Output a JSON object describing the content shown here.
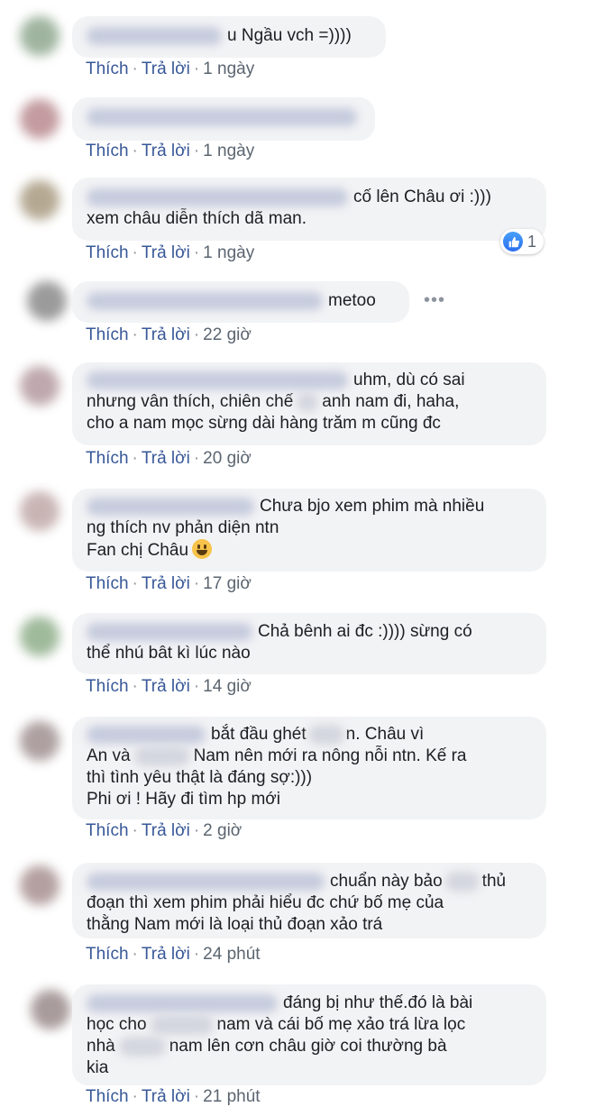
{
  "actions": {
    "like": "Thích",
    "reply": "Trả lời",
    "separator": "·"
  },
  "colors": {
    "link": "#385898",
    "bubble": "#f2f3f5",
    "like_badge": "#2a6ef0"
  },
  "comments": [
    {
      "lines": [
        "u Ngầu vch =))))"
      ],
      "time": "1 ngày"
    },
    {
      "lines": [],
      "time": "1 ngày"
    },
    {
      "lines": [
        "cố lên Châu ơi :)))",
        "xem châu diễn thích dã man."
      ],
      "time": "1 ngày",
      "reaction": {
        "icon": "like-icon",
        "count": "1"
      }
    },
    {
      "lines": [
        "metoo"
      ],
      "time": "22 giờ",
      "more": "•••"
    },
    {
      "lines": [
        "uhm, dù có sai",
        "nhưng vân thích, chiên chế",
        "anh nam đi, haha,",
        "cho a nam mọc sừng dài hàng trăm m cũng đc"
      ],
      "time": "20 giờ"
    },
    {
      "lines": [
        "Chưa bjo xem phim mà nhiều",
        "ng thích nv phản diện ntn",
        "Fan chị Châu"
      ],
      "time": "17 giờ",
      "emoji": "grinning-face"
    },
    {
      "lines": [
        "Chả bênh ai đc :)))) sừng có",
        "thể nhú bât kì lúc nào"
      ],
      "time": "14 giờ"
    },
    {
      "lines": [
        "bắt đầu ghét",
        "n. Châu vì",
        "An và",
        "Nam nên mới ra nông nỗi ntn. Kế ra",
        "thì tình yêu thật là đáng sợ:)))",
        "Phi ơi ! Hãy đi tìm hp mới"
      ],
      "time": "2 giờ"
    },
    {
      "lines": [
        "chuẩn này bảo",
        "thủ",
        "đoạn thì xem phim phải hiểu đc chứ bố mẹ của",
        "thằng Nam mới là loại thủ đoạn xảo trá"
      ],
      "time": "24 phút"
    },
    {
      "lines": [
        "đáng bị như thế.đó là bài",
        "học cho",
        "nam và cái bố mẹ xảo trá lừa lọc",
        "nhà",
        "nam lên cơn châu giờ coi thường bà",
        "kia"
      ],
      "time": "21 phút"
    }
  ]
}
